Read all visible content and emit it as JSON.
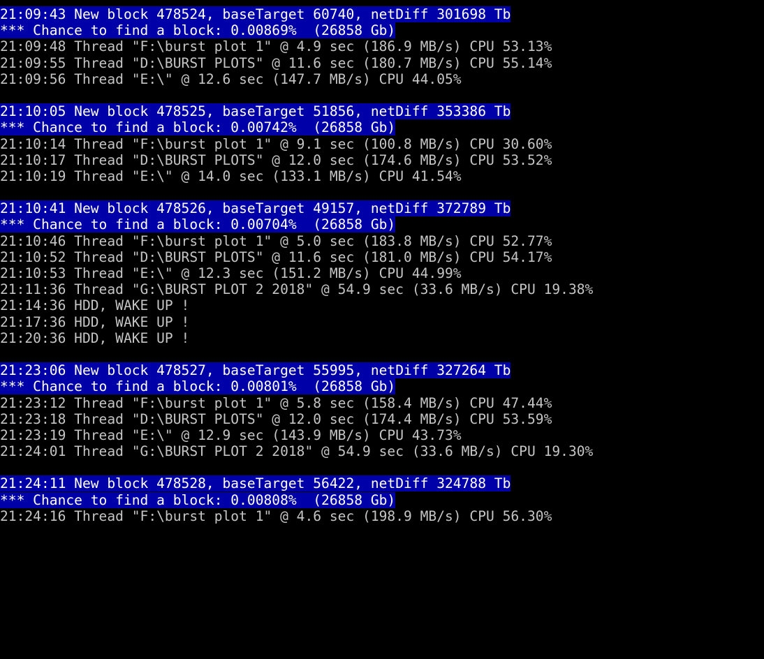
{
  "terminal": {
    "title": "burst miner console log",
    "colors": {
      "background": "#000000",
      "foreground": "#c5c5c5",
      "highlight_background": "#0000a8",
      "highlight_foreground": "#ffffff"
    },
    "lines": [
      {
        "text": "21:09:43 New block 478524, baseTarget 60740, netDiff 301698 Tb",
        "highlight": true
      },
      {
        "text": "*** Chance to find a block: 0.00869%  (26858 Gb)",
        "highlight": true
      },
      {
        "text": "21:09:48 Thread \"F:\\burst plot 1\" @ 4.9 sec (186.9 MB/s) CPU 53.13%",
        "highlight": false
      },
      {
        "text": "21:09:55 Thread \"D:\\BURST PLOTS\" @ 11.6 sec (180.7 MB/s) CPU 55.14%",
        "highlight": false
      },
      {
        "text": "21:09:56 Thread \"E:\\\" @ 12.6 sec (147.7 MB/s) CPU 44.05%",
        "highlight": false
      },
      {
        "text": "",
        "highlight": false
      },
      {
        "text": "21:10:05 New block 478525, baseTarget 51856, netDiff 353386 Tb",
        "highlight": true
      },
      {
        "text": "*** Chance to find a block: 0.00742%  (26858 Gb)",
        "highlight": true
      },
      {
        "text": "21:10:14 Thread \"F:\\burst plot 1\" @ 9.1 sec (100.8 MB/s) CPU 30.60%",
        "highlight": false
      },
      {
        "text": "21:10:17 Thread \"D:\\BURST PLOTS\" @ 12.0 sec (174.6 MB/s) CPU 53.52%",
        "highlight": false
      },
      {
        "text": "21:10:19 Thread \"E:\\\" @ 14.0 sec (133.1 MB/s) CPU 41.54%",
        "highlight": false
      },
      {
        "text": "",
        "highlight": false
      },
      {
        "text": "21:10:41 New block 478526, baseTarget 49157, netDiff 372789 Tb",
        "highlight": true
      },
      {
        "text": "*** Chance to find a block: 0.00704%  (26858 Gb)",
        "highlight": true
      },
      {
        "text": "21:10:46 Thread \"F:\\burst plot 1\" @ 5.0 sec (183.8 MB/s) CPU 52.77%",
        "highlight": false
      },
      {
        "text": "21:10:52 Thread \"D:\\BURST PLOTS\" @ 11.6 sec (181.0 MB/s) CPU 54.17%",
        "highlight": false
      },
      {
        "text": "21:10:53 Thread \"E:\\\" @ 12.3 sec (151.2 MB/s) CPU 44.99%",
        "highlight": false
      },
      {
        "text": "21:11:36 Thread \"G:\\BURST PLOT 2 2018\" @ 54.9 sec (33.6 MB/s) CPU 19.38%",
        "highlight": false
      },
      {
        "text": "21:14:36 HDD, WAKE UP !",
        "highlight": false
      },
      {
        "text": "21:17:36 HDD, WAKE UP !",
        "highlight": false
      },
      {
        "text": "21:20:36 HDD, WAKE UP !",
        "highlight": false
      },
      {
        "text": "",
        "highlight": false
      },
      {
        "text": "21:23:06 New block 478527, baseTarget 55995, netDiff 327264 Tb",
        "highlight": true
      },
      {
        "text": "*** Chance to find a block: 0.00801%  (26858 Gb)",
        "highlight": true
      },
      {
        "text": "21:23:12 Thread \"F:\\burst plot 1\" @ 5.8 sec (158.4 MB/s) CPU 47.44%",
        "highlight": false
      },
      {
        "text": "21:23:18 Thread \"D:\\BURST PLOTS\" @ 12.0 sec (174.4 MB/s) CPU 53.59%",
        "highlight": false
      },
      {
        "text": "21:23:19 Thread \"E:\\\" @ 12.9 sec (143.9 MB/s) CPU 43.73%",
        "highlight": false
      },
      {
        "text": "21:24:01 Thread \"G:\\BURST PLOT 2 2018\" @ 54.9 sec (33.6 MB/s) CPU 19.30%",
        "highlight": false
      },
      {
        "text": "",
        "highlight": false
      },
      {
        "text": "21:24:11 New block 478528, baseTarget 56422, netDiff 324788 Tb",
        "highlight": true
      },
      {
        "text": "*** Chance to find a block: 0.00808%  (26858 Gb)",
        "highlight": true
      },
      {
        "text": "21:24:16 Thread \"F:\\burst plot 1\" @ 4.6 sec (198.9 MB/s) CPU 56.30%",
        "highlight": false
      }
    ],
    "blocks": [
      {
        "time": "21:09:43",
        "block": "478524",
        "base_target": "60740",
        "net_diff": "301698 Tb",
        "chance": "0.00869%",
        "capacity": "26858 Gb",
        "threads": [
          {
            "time": "21:09:48",
            "path": "F:\\burst plot 1",
            "seconds": "4.9",
            "speed": "186.9 MB/s",
            "cpu": "53.13%"
          },
          {
            "time": "21:09:55",
            "path": "D:\\BURST PLOTS",
            "seconds": "11.6",
            "speed": "180.7 MB/s",
            "cpu": "55.14%"
          },
          {
            "time": "21:09:56",
            "path": "E:\\",
            "seconds": "12.6",
            "speed": "147.7 MB/s",
            "cpu": "44.05%"
          }
        ]
      },
      {
        "time": "21:10:05",
        "block": "478525",
        "base_target": "51856",
        "net_diff": "353386 Tb",
        "chance": "0.00742%",
        "capacity": "26858 Gb",
        "threads": [
          {
            "time": "21:10:14",
            "path": "F:\\burst plot 1",
            "seconds": "9.1",
            "speed": "100.8 MB/s",
            "cpu": "30.60%"
          },
          {
            "time": "21:10:17",
            "path": "D:\\BURST PLOTS",
            "seconds": "12.0",
            "speed": "174.6 MB/s",
            "cpu": "53.52%"
          },
          {
            "time": "21:10:19",
            "path": "E:\\",
            "seconds": "14.0",
            "speed": "133.1 MB/s",
            "cpu": "41.54%"
          }
        ]
      },
      {
        "time": "21:10:41",
        "block": "478526",
        "base_target": "49157",
        "net_diff": "372789 Tb",
        "chance": "0.00704%",
        "capacity": "26858 Gb",
        "threads": [
          {
            "time": "21:10:46",
            "path": "F:\\burst plot 1",
            "seconds": "5.0",
            "speed": "183.8 MB/s",
            "cpu": "52.77%"
          },
          {
            "time": "21:10:52",
            "path": "D:\\BURST PLOTS",
            "seconds": "11.6",
            "speed": "181.0 MB/s",
            "cpu": "54.17%"
          },
          {
            "time": "21:10:53",
            "path": "E:\\",
            "seconds": "12.3",
            "speed": "151.2 MB/s",
            "cpu": "44.99%"
          },
          {
            "time": "21:11:36",
            "path": "G:\\BURST PLOT 2 2018",
            "seconds": "54.9",
            "speed": "33.6 MB/s",
            "cpu": "19.38%"
          }
        ],
        "notices": [
          {
            "time": "21:14:36",
            "text": "HDD, WAKE UP !"
          },
          {
            "time": "21:17:36",
            "text": "HDD, WAKE UP !"
          },
          {
            "time": "21:20:36",
            "text": "HDD, WAKE UP !"
          }
        ]
      },
      {
        "time": "21:23:06",
        "block": "478527",
        "base_target": "55995",
        "net_diff": "327264 Tb",
        "chance": "0.00801%",
        "capacity": "26858 Gb",
        "threads": [
          {
            "time": "21:23:12",
            "path": "F:\\burst plot 1",
            "seconds": "5.8",
            "speed": "158.4 MB/s",
            "cpu": "47.44%"
          },
          {
            "time": "21:23:18",
            "path": "D:\\BURST PLOTS",
            "seconds": "12.0",
            "speed": "174.4 MB/s",
            "cpu": "53.59%"
          },
          {
            "time": "21:23:19",
            "path": "E:\\",
            "seconds": "12.9",
            "speed": "143.9 MB/s",
            "cpu": "43.73%"
          },
          {
            "time": "21:24:01",
            "path": "G:\\BURST PLOT 2 2018",
            "seconds": "54.9",
            "speed": "33.6 MB/s",
            "cpu": "19.30%"
          }
        ]
      },
      {
        "time": "21:24:11",
        "block": "478528",
        "base_target": "56422",
        "net_diff": "324788 Tb",
        "chance": "0.00808%",
        "capacity": "26858 Gb",
        "threads": [
          {
            "time": "21:24:16",
            "path": "F:\\burst plot 1",
            "seconds": "4.6",
            "speed": "198.9 MB/s",
            "cpu": "56.30%"
          }
        ]
      }
    ]
  }
}
